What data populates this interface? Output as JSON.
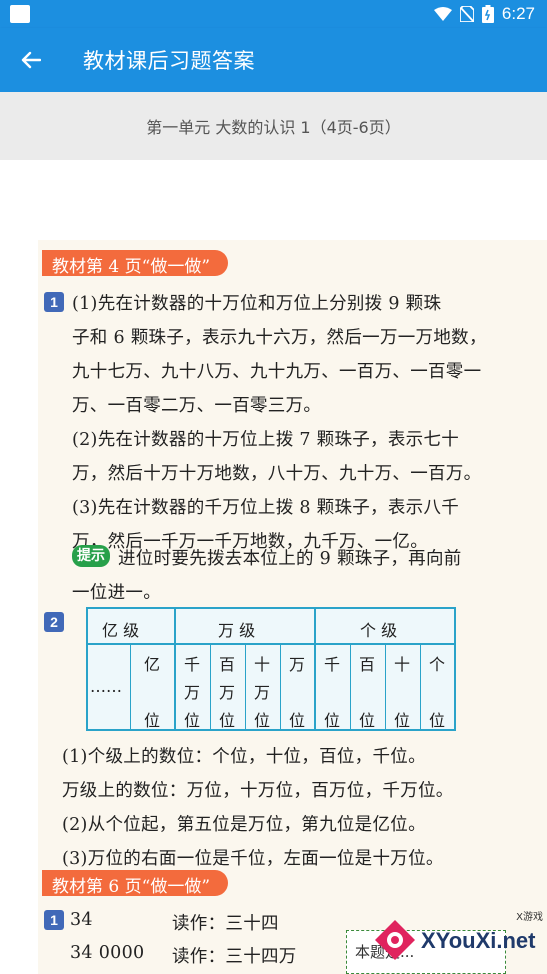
{
  "status_bar": {
    "time": "6:27"
  },
  "app_bar": {
    "title": "教材课后习题答案"
  },
  "subheader": {
    "text": "第一单元 大数的认识 1（4页-6页）"
  },
  "page": {
    "banner1": "教材第 4 页“做一做”",
    "item1_number": "1",
    "lines1": [
      "(1)先在计数器的十万位和万位上分别拨 9 颗珠",
      "子和 6 颗珠子，表示九十六万，然后一万一万地数，",
      "九十七万、九十八万、九十九万、一百万、一百零一",
      "万、一百零二万、一百零三万。",
      "(2)先在计数器的十万位上拨 7 颗珠子，表示七十",
      "万，然后十万十万地数，八十万、九十万、一百万。",
      "(3)先在计数器的千万位上拨 8 颗珠子，表示八千",
      "万，然后一千万一千万地数，九千万、一亿。"
    ],
    "hint_label": "提示",
    "hint_lines": [
      "进位时要先拨去本位上的 9 颗珠子，再向前",
      "一位进一。"
    ],
    "item2_number": "2",
    "table": {
      "headers": [
        "亿  级",
        "万  级",
        "个  级"
      ],
      "dots": "……",
      "cols": [
        [
          "亿",
          "",
          "位"
        ],
        [
          "千",
          "万",
          "位"
        ],
        [
          "百",
          "万",
          "位"
        ],
        [
          "十",
          "万",
          "位"
        ],
        [
          "万",
          "",
          "位"
        ],
        [
          "千",
          "",
          "位"
        ],
        [
          "百",
          "",
          "位"
        ],
        [
          "十",
          "",
          "位"
        ],
        [
          "个",
          "",
          "位"
        ]
      ]
    },
    "lines2": [
      "(1)个级上的数位：个位，十位，百位，千位。",
      "万级上的数位：万位，十万位，百万位，千万位。",
      "(2)从个位起，第五位是万位，第九位是亿位。",
      "(3)万位的右面一位是千位，左面一位是十万位。"
    ],
    "banner2": "教材第 6 页“做一做”",
    "item3_number": "1",
    "rows3": [
      {
        "num": "34",
        "read": "读作：三十四"
      },
      {
        "num": "34 0000",
        "read": "读作：三十四万"
      }
    ],
    "note": "本题是...",
    "watermark": {
      "brand": "XYouXi.net",
      "small": "X游戏"
    }
  }
}
